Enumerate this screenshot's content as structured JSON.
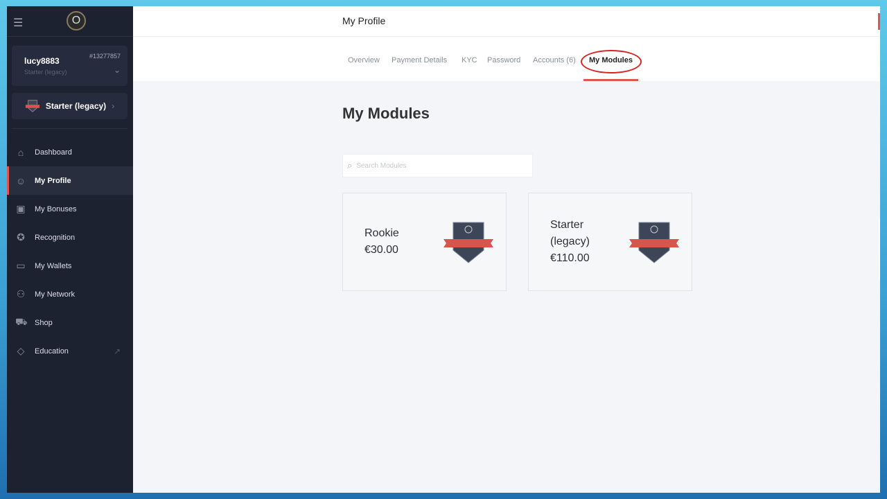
{
  "user": {
    "name": "lucy8883",
    "plan": "Starter (legacy)",
    "id": "#13277857"
  },
  "plan_button": "Starter (legacy)",
  "nav": [
    {
      "label": "Dashboard",
      "icon": "⌂"
    },
    {
      "label": "My Profile",
      "icon": "☺"
    },
    {
      "label": "My Bonuses",
      "icon": "▣"
    },
    {
      "label": "Recognition",
      "icon": "✪"
    },
    {
      "label": "My Wallets",
      "icon": "▭"
    },
    {
      "label": "My Network",
      "icon": "⚇"
    },
    {
      "label": "Shop",
      "icon": "⛟"
    },
    {
      "label": "Education",
      "icon": "◇"
    }
  ],
  "header": {
    "title": "My Profile"
  },
  "tabs": [
    "Overview",
    "Payment Details",
    "KYC",
    "Password",
    "Accounts (6)",
    "My Modules"
  ],
  "page_title": "My Modules",
  "search": {
    "placeholder": "Search Modules"
  },
  "modules": [
    {
      "name": "Rookie",
      "price": "€30.00"
    },
    {
      "name": "Starter (legacy)",
      "name1": "Starter",
      "name2": "(legacy)",
      "price": "€110.00"
    }
  ],
  "colors": {
    "accent": "#e0554d",
    "sidebar": "#1d2230"
  }
}
